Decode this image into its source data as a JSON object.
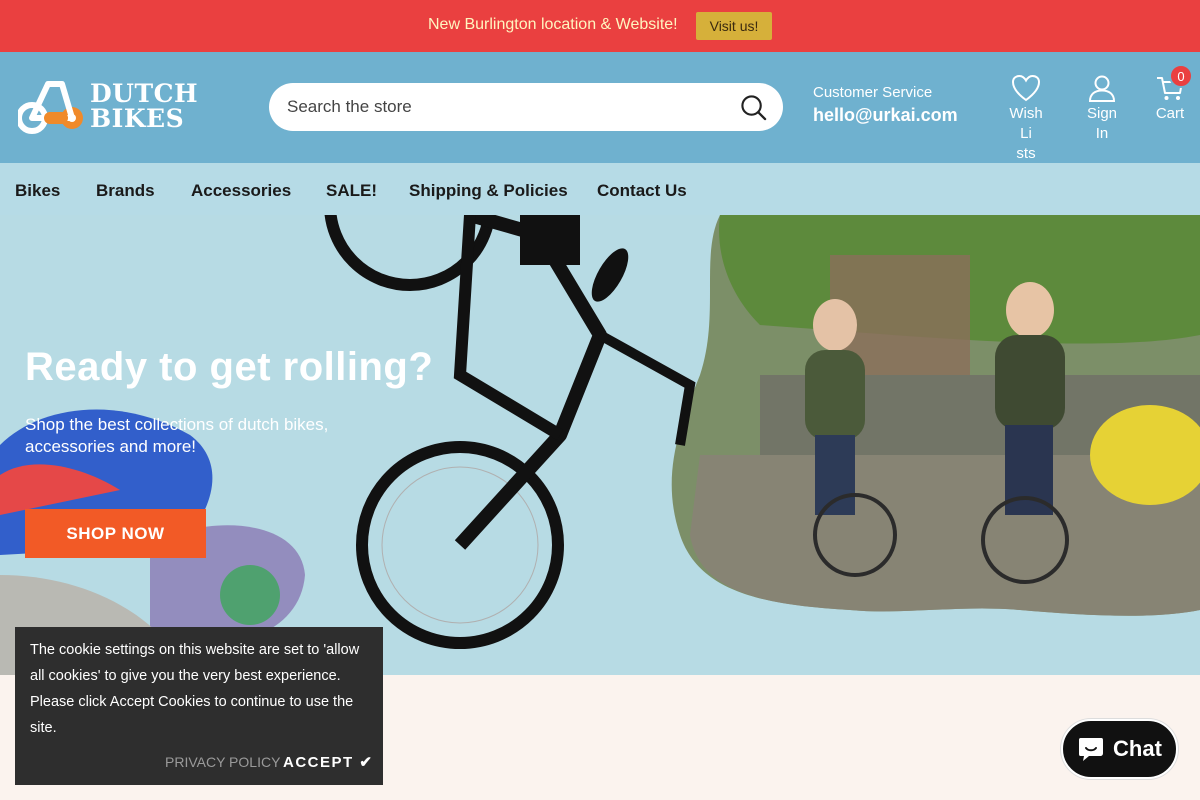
{
  "announcement": {
    "text": "New Burlington location & Website!",
    "button_label": "Visit us!"
  },
  "header": {
    "logo_line1": "DUTCH",
    "logo_line2": "BIKES",
    "search_placeholder": "Search the store",
    "customer_service_label": "Customer Service",
    "customer_service_email": "hello@urkai.com",
    "wishlist_label_line1": "Wish Li",
    "wishlist_label_line2": "sts",
    "signin_label_line1": "Sign",
    "signin_label_line2": "In",
    "cart_label": "Cart",
    "cart_count": "0"
  },
  "nav": {
    "items": [
      "Bikes",
      "Brands",
      "Accessories",
      "SALE!",
      "Shipping & Policies",
      "Contact Us"
    ]
  },
  "hero": {
    "title": "Ready to get rolling?",
    "subtitle": "Shop the best collections of dutch bikes, accessories and more!",
    "button_label": "SHOP NOW"
  },
  "cookie": {
    "text": "The cookie settings on this website are set to 'allow all cookies' to give you the very best experience. Please click Accept Cookies to continue to use the site.",
    "privacy_label": "PRIVACY POLICY",
    "accept_label": "ACCEPT ✔"
  },
  "chat": {
    "label": "Chat"
  },
  "colors": {
    "announcement_bg": "#ea4040",
    "header_bg": "#6fb1cf",
    "nav_bg": "#b6dbe6",
    "hero_bg": "#b7dbe4",
    "cta": "#f25a26"
  }
}
